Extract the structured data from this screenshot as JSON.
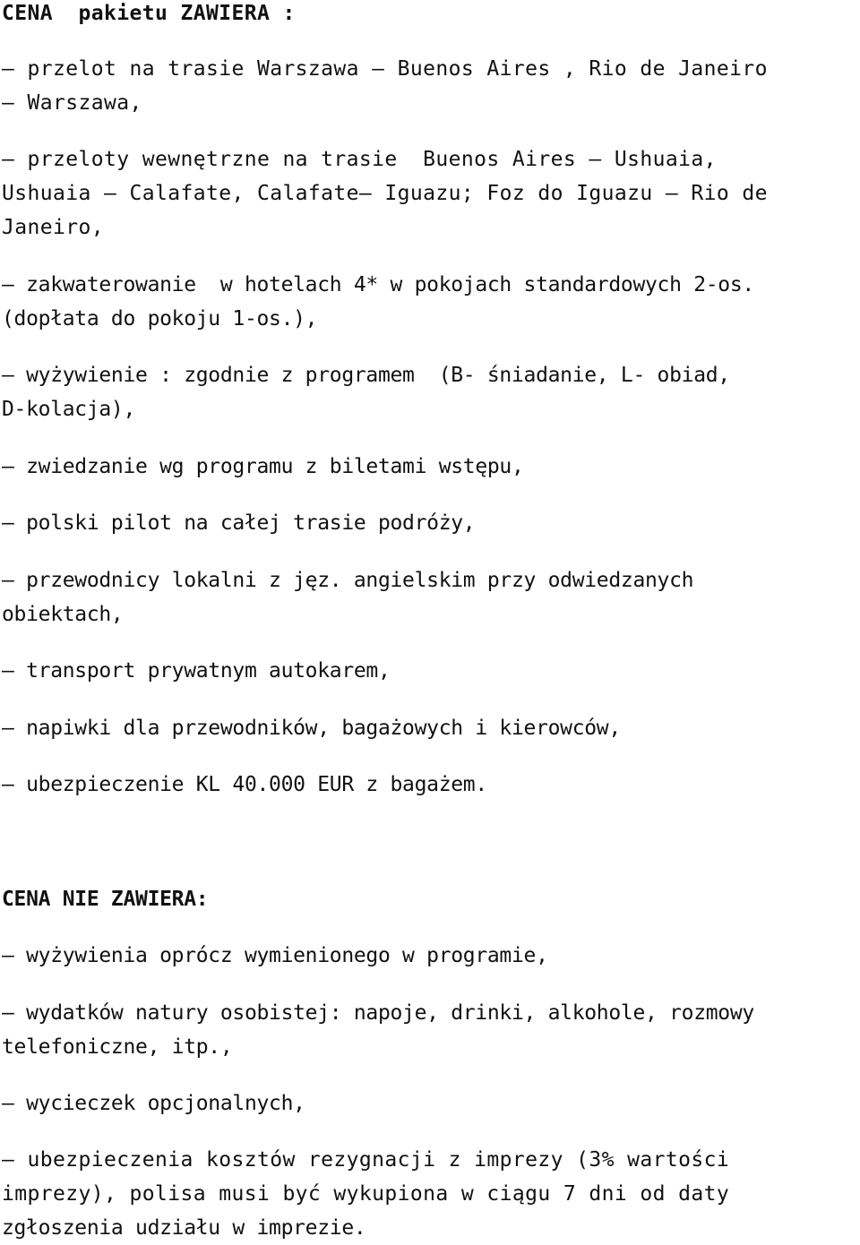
{
  "included": {
    "heading": "CENA  pakietu ZAWIERA :",
    "items": [
      {
        "lines": [
          "– przelot na trasie Warszawa – Buenos Aires , Rio de Janeiro",
          "– Warszawa,"
        ]
      },
      {
        "lines": [
          "– przeloty wewnętrzne na trasie  Buenos Aires – Ushuaia,",
          "Ushuaia – Calafate, Calafate– Iguazu; Foz do Iguazu – Rio de",
          "Janeiro,"
        ]
      },
      {
        "lines": [
          "– zakwaterowanie  w hotelach 4* w pokojach standardowych 2-os.",
          "(dopłata do pokoju 1-os.),"
        ]
      },
      {
        "lines": [
          "– wyżywienie : zgodnie z programem  (B- śniadanie, L- obiad,",
          "D-kolacja),"
        ]
      },
      {
        "lines": [
          "– zwiedzanie wg programu z biletami wstępu,"
        ]
      },
      {
        "lines": [
          "– polski pilot na całej trasie podróży,"
        ]
      },
      {
        "lines": [
          "– przewodnicy lokalni z jęz. angielskim przy odwiedzanych",
          "obiektach,"
        ]
      },
      {
        "lines": [
          "– transport prywatnym autokarem,"
        ]
      },
      {
        "lines": [
          "– napiwki dla przewodników, bagażowych i kierowców,"
        ]
      },
      {
        "lines": [
          "– ubezpieczenie KL 40.000 EUR z bagażem."
        ]
      }
    ]
  },
  "excluded": {
    "heading": "CENA NIE ZAWIERA:",
    "items": [
      {
        "lines": [
          "– wyżywienia oprócz wymienionego w programie,"
        ]
      },
      {
        "lines": [
          "– wydatków natury osobistej: napoje, drinki, alkohole, rozmowy",
          "telefoniczne, itp.,"
        ]
      },
      {
        "lines": [
          "– wycieczek opcjonalnych,"
        ]
      },
      {
        "lines": [
          "– ubezpieczenia kosztów rezygnacji z imprezy (3% wartości",
          "imprezy), polisa musi być wykupiona w ciągu 7 dni od daty",
          "zgłoszenia udziału w imprezie."
        ]
      }
    ]
  }
}
